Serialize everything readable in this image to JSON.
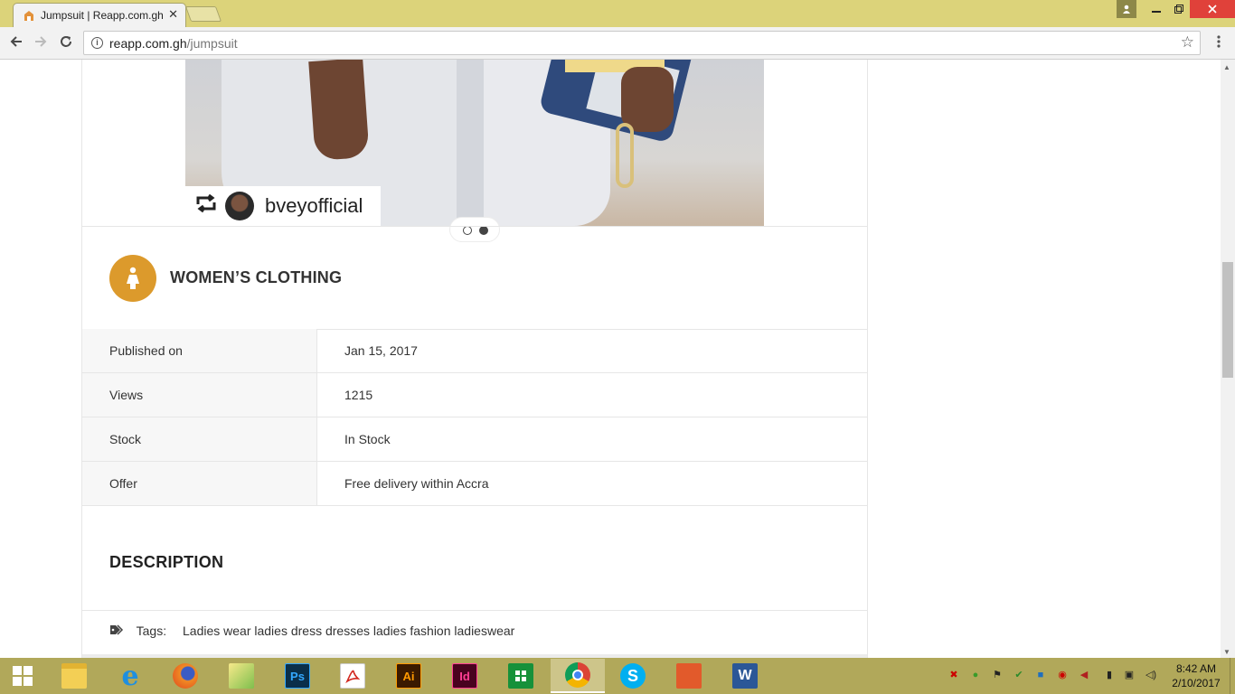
{
  "browser": {
    "tab_title": "Jumpsuit | Reapp.com.gh",
    "tab_close": "✕",
    "url_host": "reapp.com.gh",
    "url_path": "/jumpsuit"
  },
  "photo": {
    "repost_username": "bveyofficial",
    "slide_count": 2,
    "active_slide": 2
  },
  "category": {
    "title": "WOMEN’S CLOTHING",
    "color": "#dc9a2c"
  },
  "details": [
    {
      "label": "Published on",
      "value": "Jan 15, 2017"
    },
    {
      "label": "Views",
      "value": "1215"
    },
    {
      "label": "Stock",
      "value": "In Stock"
    },
    {
      "label": "Offer",
      "value": "Free delivery within Accra"
    }
  ],
  "description": {
    "title": "DESCRIPTION"
  },
  "tags": {
    "label": "Tags:",
    "items": "Ladies wear ladies dress dresses ladies fashion ladieswear"
  },
  "taskbar": {
    "apps": [
      "file-explorer",
      "internet-explorer",
      "firefox",
      "paint-app",
      "photoshop",
      "acrobat-reader",
      "illustrator",
      "indesign",
      "store",
      "chrome",
      "skype",
      "office-app",
      "word"
    ],
    "ps_label": "Ps",
    "ai_label": "Ai",
    "id_label": "Id",
    "w_label": "W",
    "active_app": "chrome"
  },
  "clock": {
    "time": "8:42 AM",
    "date": "2/10/2017"
  }
}
